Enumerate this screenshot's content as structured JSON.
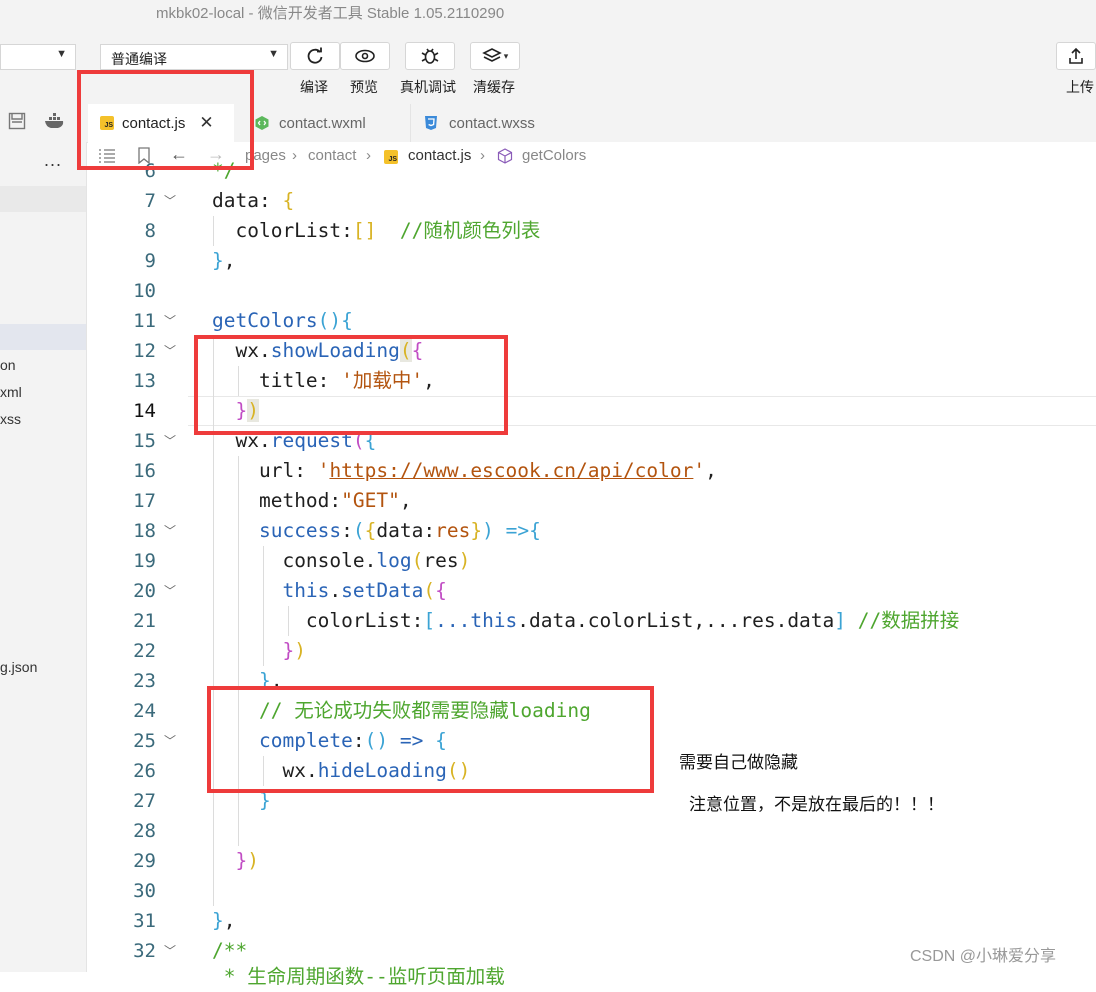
{
  "window": {
    "title": "mkbk02-local  -  微信开发者工具 Stable 1.05.2110290"
  },
  "toolbar": {
    "compile_mode": "普通编译",
    "buttons": [
      {
        "label": "编译",
        "icon": "refresh-icon"
      },
      {
        "label": "预览",
        "icon": "eye-icon"
      },
      {
        "label": "真机调试",
        "icon": "bug-icon"
      },
      {
        "label": "清缓存",
        "icon": "layers-icon"
      }
    ],
    "upload_label": "上传"
  },
  "tabs": [
    {
      "label": "contact.js",
      "active": true
    },
    {
      "label": "contact.wxml",
      "active": false
    },
    {
      "label": "contact.wxss",
      "active": false
    }
  ],
  "breadcrumb": {
    "items": [
      "pages",
      "contact",
      "contact.js",
      "getColors"
    ]
  },
  "sidebar": {
    "more": "...",
    "items": [
      "on",
      "xml",
      "xss",
      "g.json"
    ]
  },
  "editor": {
    "line_numbers": [
      6,
      7,
      8,
      9,
      10,
      11,
      12,
      13,
      14,
      15,
      16,
      17,
      18,
      19,
      20,
      21,
      22,
      23,
      24,
      25,
      26,
      27,
      28,
      29,
      30,
      31,
      32
    ],
    "current_line": 14,
    "foldable_lines": [
      7,
      11,
      12,
      15,
      18,
      20,
      25,
      32
    ],
    "code": {
      "l7_key": "data",
      "l8_key": "colorList",
      "l8_comment": "//随机颜色列表",
      "l11_fn": "getColors",
      "l12_obj": "wx",
      "l12_fn": "showLoading",
      "l13_key": "title",
      "l13_val": "'加载中'",
      "l15_obj": "wx",
      "l15_fn": "request",
      "l16_key": "url",
      "l16_val": "https://www.escook.cn/api/color",
      "l17_key": "method",
      "l17_val": "\"GET\"",
      "l18_key": "success",
      "l18_param_a": "data",
      "l18_param_b": "res",
      "l19_obj": "console",
      "l19_fn": "log",
      "l19_arg": "res",
      "l20_this": "this",
      "l20_fn": "setData",
      "l21_key": "colorList",
      "l21_this": "this",
      "l21_rest": ".data.colorList,...res.data",
      "l21_comment": "//数据拼接",
      "l24_comment": "// 无论成功失败都需要隐藏loading",
      "l25_key": "complete",
      "l26_obj": "wx",
      "l26_fn": "hideLoading",
      "l32_comment": "/**",
      "l33_partial": "* 生命周期函数--监听页面加载"
    }
  },
  "annotations": {
    "note1": "需要自己做隐藏",
    "note2": "注意位置，不是放在最后的！！！"
  },
  "watermark": "CSDN @小琳爱分享",
  "colors": {
    "highlight_red": "#ee3b3b",
    "keyword_blue": "#2a64b6",
    "string_brown": "#b3540f",
    "comment_green": "#4ea62f"
  }
}
